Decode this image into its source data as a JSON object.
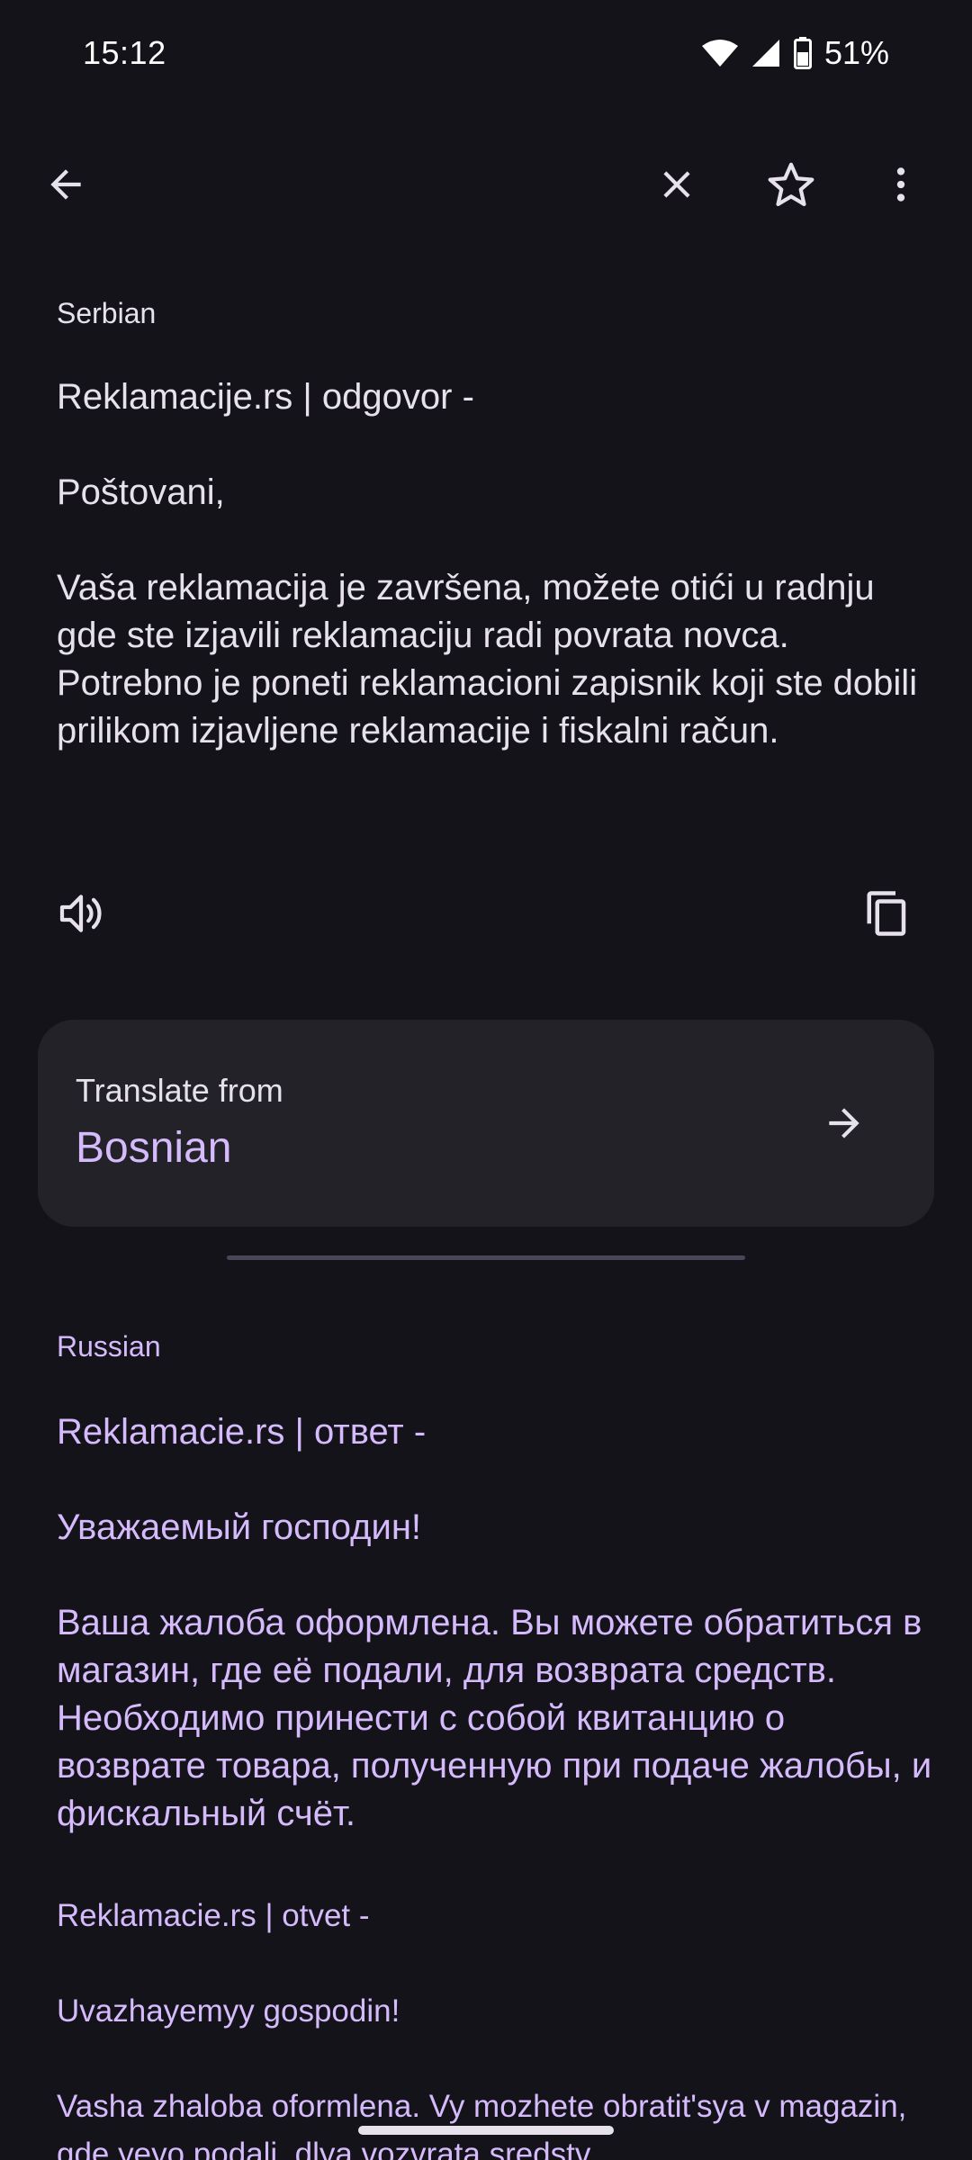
{
  "status_bar": {
    "time": "15:12",
    "battery_percent": "51%",
    "icons": [
      "wifi-icon",
      "cell-signal-icon",
      "battery-icon"
    ]
  },
  "app_bar": {
    "icons": [
      "back-arrow-icon",
      "close-icon",
      "star-icon",
      "more-vert-icon"
    ]
  },
  "source": {
    "language": "Serbian",
    "text": "Reklamacije.rs | odgovor -\n\nPoštovani,\n\nVaša reklamacija je završena, možete otići u radnju gde ste izjavili reklamaciju radi povrata novca. Potrebno je poneti reklamacioni zapisnik koji ste dobili prilikom izjavljene reklamacije i fiskalni račun."
  },
  "actions": {
    "icons": [
      "speaker-icon",
      "copy-icon"
    ]
  },
  "translate_from": {
    "title": "Translate from",
    "language": "Bosnian"
  },
  "target": {
    "language": "Russian",
    "text": "Reklamacie.rs | ответ -\n\nУважаемый господин!\n\nВаша жалоба оформлена. Вы можете обратиться в магазин, где её подали, для возврата средств. Необходимо принести с собой квитанцию о возврате товара, полученную при подаче жалобы, и фискальный счёт.",
    "transliteration": "Reklamacie.rs | otvet -\n\nUvazhayemyy gospodin!\n\nVasha zhaloba oformlena. Vy mozhete obratit'sya v magazin, gde yeyo podali, dlya vozvrata sredstv."
  },
  "colors": {
    "background": "#14131a",
    "card": "#242229",
    "accent": "#d5bbfc",
    "text": "#e6e1ea"
  }
}
